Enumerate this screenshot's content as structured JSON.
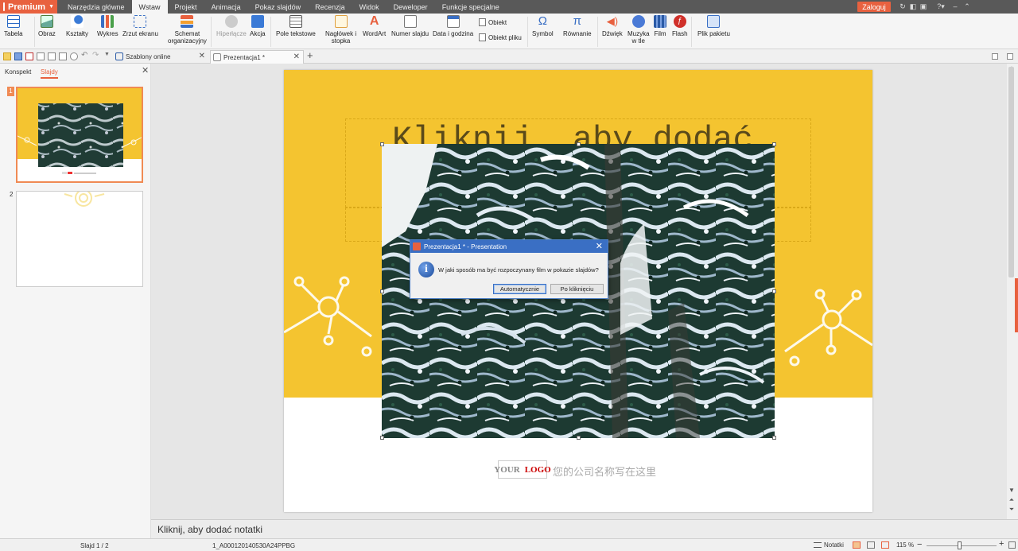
{
  "menubar": {
    "brand": "Premium",
    "tabs": [
      "Narzędzia główne",
      "Wstaw",
      "Projekt",
      "Animacja",
      "Pokaz slajdów",
      "Recenzja",
      "Widok",
      "Deweloper",
      "Funkcje specjalne"
    ],
    "active_tab": "Wstaw",
    "login_label": "Zaloguj"
  },
  "ribbon": {
    "table": "Tabela",
    "picture": "Obraz",
    "shapes": "Kształty",
    "chart": "Wykres",
    "screenshot": "Zrzut ekranu",
    "smartart_1": "Schemat",
    "smartart_2": "organizacyjny",
    "hyperlink": "Hiperłącze",
    "action": "Akcja",
    "textbox": "Pole tekstowe",
    "header_1": "Nagłówek i",
    "header_2": "stopka",
    "wordart": "WordArt",
    "slide_number": "Numer slajdu",
    "date_time": "Data i godzina",
    "object": "Obiekt",
    "object_file": "Obiekt pliku",
    "symbol": "Symbol",
    "equation": "Równanie",
    "sound": "Dźwięk",
    "bg_music_1": "Muzyka",
    "bg_music_2": "w tle",
    "film": "Film",
    "flash": "Flash",
    "package_file": "Plik pakietu"
  },
  "doc_tabs": [
    {
      "label": "Szablony online"
    },
    {
      "label": "Prezentacja1 *"
    }
  ],
  "left_panel": {
    "tab_outline": "Konspekt",
    "tab_slides": "Slajdy",
    "slide_numbers": [
      "1",
      "2"
    ]
  },
  "slide": {
    "title_placeholder": "Kliknij, aby dodać",
    "logo_your": "YOUR",
    "logo_logo": "LOGO",
    "company_text": "您的公司名称写在这里"
  },
  "notes_placeholder": "Kliknij, aby dodać notatki",
  "status": {
    "slide_count": "Slajd 1 / 2",
    "theme": "1_A000120140530A24PPBG",
    "notes_label": "Notatki",
    "zoom": "115 %",
    "zoom_level_percent": 47
  },
  "dialog": {
    "title": "Prezentacja1 * - Presentation",
    "message": "W jaki sposób ma być rozpoczynany film w pokazie slajdów?",
    "btn_auto": "Automatycznie",
    "btn_click": "Po kliknięciu"
  },
  "colors": {
    "accent": "#e8613f",
    "slide_yellow": "#f4c430",
    "dialog_blue": "#3a6fc4"
  }
}
